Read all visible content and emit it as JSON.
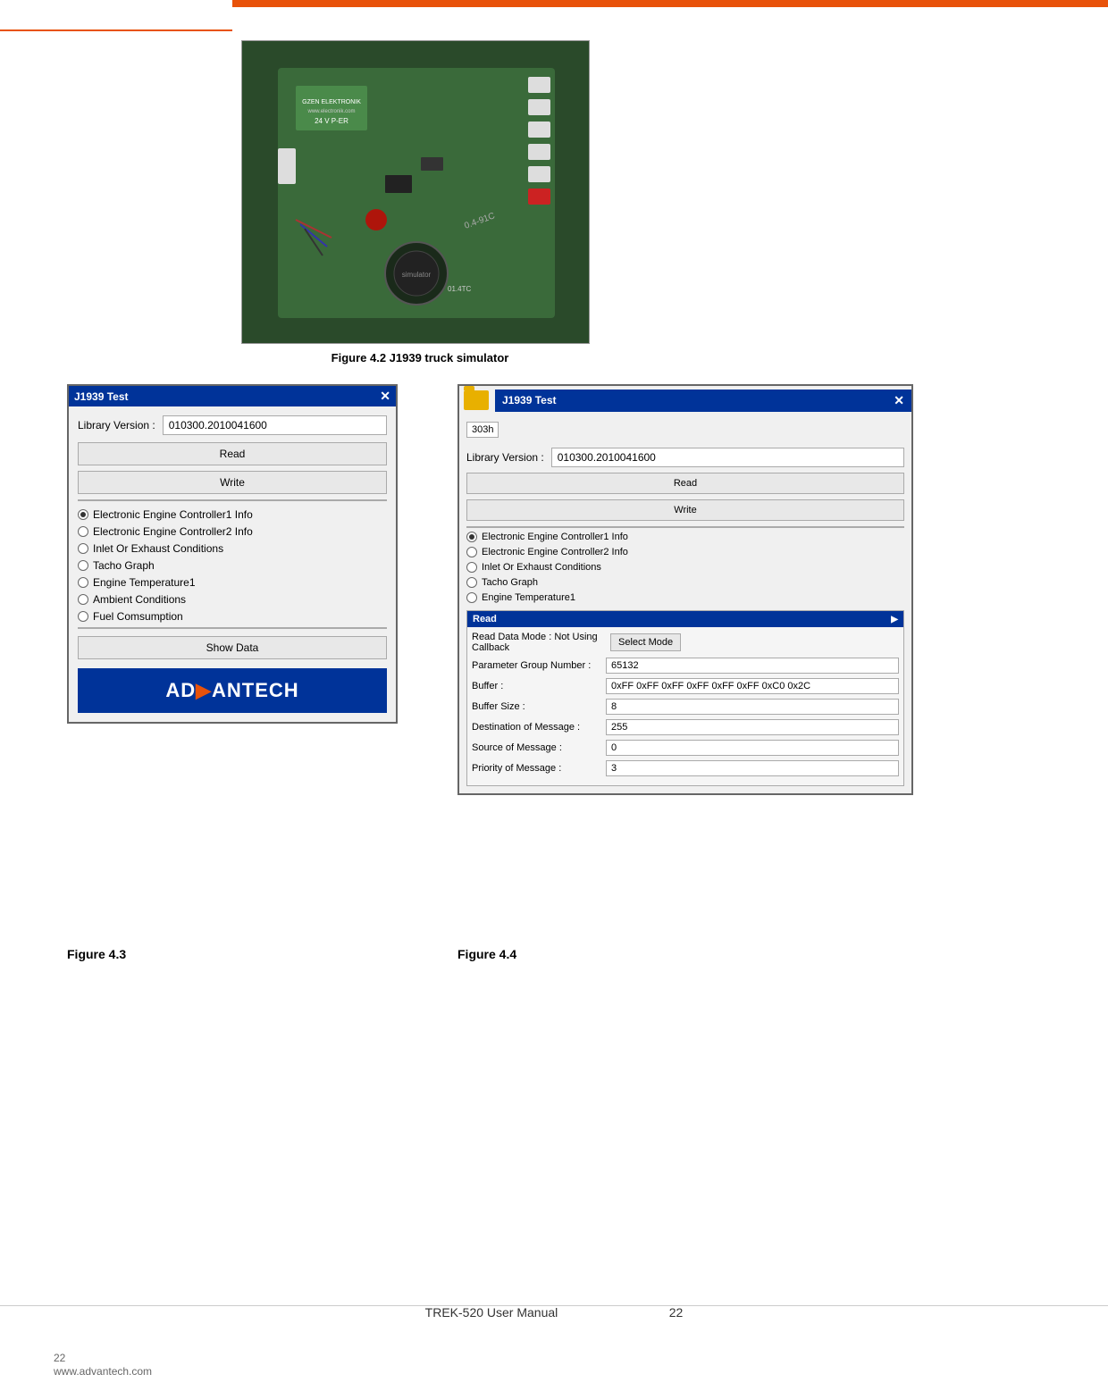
{
  "header": {
    "top_bar_color": "#e8520a"
  },
  "figure42": {
    "caption": "Figure 4.2    J1939 truck simulator"
  },
  "fig43": {
    "title": "J1939 Test",
    "lib_label": "Library Version :",
    "lib_value": "010300.2010041600",
    "read_btn": "Read",
    "write_btn": "Write",
    "radio_items": [
      {
        "label": "Electronic Engine Controller1 Info",
        "selected": true
      },
      {
        "label": "Electronic Engine Controller2 Info",
        "selected": false
      },
      {
        "label": "Inlet Or Exhaust Conditions",
        "selected": false
      },
      {
        "label": "Tacho Graph",
        "selected": false
      },
      {
        "label": "Engine Temperature1",
        "selected": false
      },
      {
        "label": "Ambient Conditions",
        "selected": false
      },
      {
        "label": "Fuel Comsumption",
        "selected": false
      }
    ],
    "show_data_btn": "Show Data",
    "logo_text": "ADVANTECH"
  },
  "fig44": {
    "title": "J1939 Test",
    "counter": "303h",
    "lib_label": "Library Version :",
    "lib_value": "010300.2010041600",
    "read_btn": "Read",
    "write_btn": "Write",
    "radio_items": [
      {
        "label": "Electronic Engine Controller1 Info",
        "selected": true
      },
      {
        "label": "Electronic Engine Controller2 Info",
        "selected": false
      },
      {
        "label": "Inlet Or Exhaust Conditions",
        "selected": false
      },
      {
        "label": "Tacho Graph",
        "selected": false
      },
      {
        "label": "Engine Temperature1",
        "selected": false
      }
    ],
    "read_section": {
      "title": "Read",
      "rows": [
        {
          "label": "Read Data Mode : Not Using Callback",
          "value": "",
          "has_btn": true,
          "btn_text": "Select Mode"
        },
        {
          "label": "Parameter Group Number :",
          "value": "65132"
        },
        {
          "label": "Buffer :",
          "value": "0xFF 0xFF 0xFF 0xFF 0xFF 0xFF 0xC0 0x2C"
        },
        {
          "label": "Buffer Size :",
          "value": "8"
        },
        {
          "label": "Destination of Message :",
          "value": "255"
        },
        {
          "label": "Source of Message :",
          "value": "0"
        },
        {
          "label": "Priority of Message :",
          "value": "3"
        }
      ]
    }
  },
  "figure_labels": {
    "fig43": "Figure 4.3",
    "fig44": "Figure 4.4"
  },
  "footer": {
    "manual_text": "TREK-520 User Manual",
    "page_number": "22",
    "page_number_bottom": "22",
    "url": "www.advantech.com"
  }
}
